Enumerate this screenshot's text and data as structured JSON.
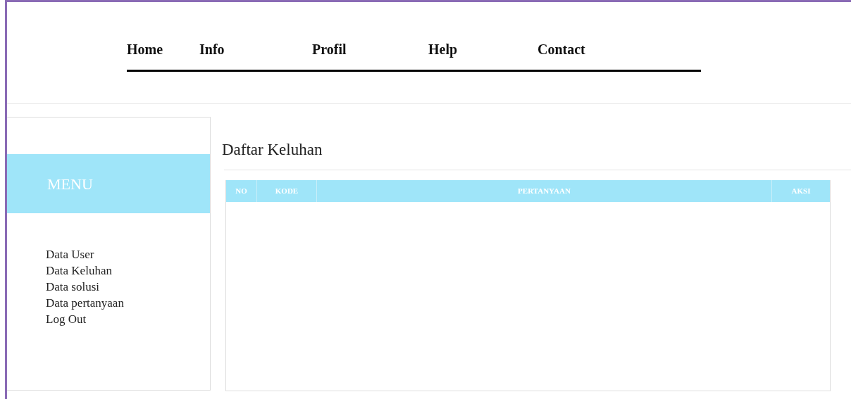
{
  "nav": [
    {
      "label": "Home"
    },
    {
      "label": "Info"
    },
    {
      "label": "Profil"
    },
    {
      "label": "Help"
    },
    {
      "label": "Contact"
    }
  ],
  "sidebar": {
    "title": "MENU",
    "items": [
      {
        "label": "Data User"
      },
      {
        "label": "Data Keluhan"
      },
      {
        "label": "Data solusi"
      },
      {
        "label": "Data pertanyaan"
      },
      {
        "label": "Log Out"
      }
    ]
  },
  "content": {
    "title": "Daftar Keluhan",
    "table": {
      "columns": [
        "NO",
        "KODE",
        "PERTANYAAN",
        "AKSI"
      ]
    }
  }
}
